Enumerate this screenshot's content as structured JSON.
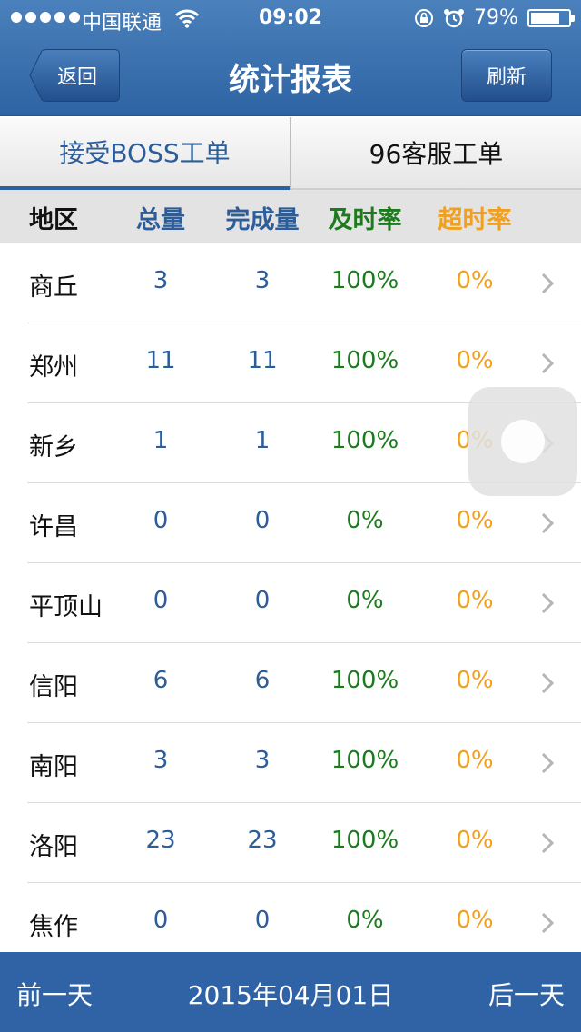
{
  "status_bar": {
    "carrier": "中国联通",
    "time": "09:02",
    "battery": "79%",
    "battery_level": 0.79
  },
  "nav": {
    "back_label": "返回",
    "title": "统计报表",
    "refresh_label": "刷新"
  },
  "tabs": [
    {
      "label": "接受BOSS工单",
      "active": true
    },
    {
      "label": "96客服工单",
      "active": false
    }
  ],
  "columns": {
    "region": "地区",
    "total": "总量",
    "completed": "完成量",
    "on_time_rate": "及时率",
    "overtime_rate": "超时率"
  },
  "rows": [
    {
      "region": "商丘",
      "total": "3",
      "completed": "3",
      "on_time": "100%",
      "overtime": "0%"
    },
    {
      "region": "郑州",
      "total": "11",
      "completed": "11",
      "on_time": "100%",
      "overtime": "0%"
    },
    {
      "region": "新乡",
      "total": "1",
      "completed": "1",
      "on_time": "100%",
      "overtime": "0%"
    },
    {
      "region": "许昌",
      "total": "0",
      "completed": "0",
      "on_time": "0%",
      "overtime": "0%"
    },
    {
      "region": "平顶山",
      "total": "0",
      "completed": "0",
      "on_time": "0%",
      "overtime": "0%"
    },
    {
      "region": "信阳",
      "total": "6",
      "completed": "6",
      "on_time": "100%",
      "overtime": "0%"
    },
    {
      "region": "南阳",
      "total": "3",
      "completed": "3",
      "on_time": "100%",
      "overtime": "0%"
    },
    {
      "region": "洛阳",
      "total": "23",
      "completed": "23",
      "on_time": "100%",
      "overtime": "0%"
    },
    {
      "region": "焦作",
      "total": "0",
      "completed": "0",
      "on_time": "0%",
      "overtime": "0%"
    }
  ],
  "footer": {
    "prev_label": "前一天",
    "date": "2015年04月01日",
    "next_label": "后一天"
  },
  "colors": {
    "brand_blue": "#2f63a5",
    "value_blue": "#2c5d99",
    "on_time_green": "#1d7a1d",
    "overtime_orange": "#f0a020"
  },
  "icons": [
    "wifi-icon",
    "lock-rotation-icon",
    "alarm-icon",
    "battery-icon",
    "chevron-right-icon"
  ]
}
